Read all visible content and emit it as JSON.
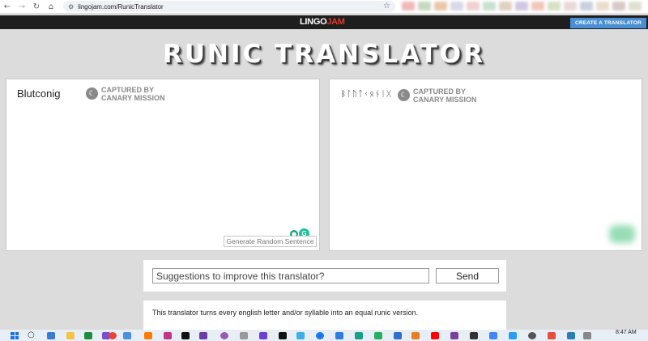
{
  "browser": {
    "url": "lingojam.com/RunicTranslator"
  },
  "site": {
    "logo_part1": "LINGO",
    "logo_part2": "JAM",
    "create_button": "CREATE A TRANSLATOR"
  },
  "title": "RUNIC TRANSLATOR",
  "input_panel": {
    "text": "Blutconig",
    "badge_line1": "CAPTURED BY",
    "badge_line2": "CANARY MISSION",
    "generate_button": "Generate Random Sentence"
  },
  "output_panel": {
    "text": "ᛒᛚᚢᛏᚲᛟᚾᛁᚷ",
    "badge_line1": "CAPTURED BY",
    "badge_line2": "CANARY MISSION"
  },
  "suggestions": {
    "placeholder": "Suggestions to improve this translator?",
    "send_label": "Send"
  },
  "description": "This translator turns every english letter and/or syllable into an equal runic version.",
  "taskbar": {
    "time": "8:47 AM"
  },
  "colors": {
    "page_bg": "#dcdcdc",
    "topbar_bg": "#1e1e1e",
    "accent_blue": "#4a8fd3",
    "logo_red": "#e03b2b",
    "badge_gray": "#8a8a8a"
  }
}
